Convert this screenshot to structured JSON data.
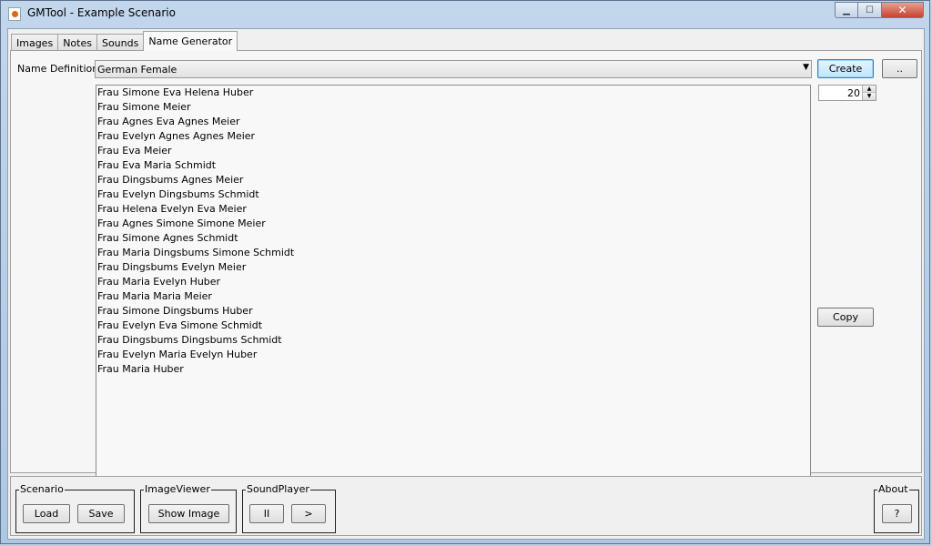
{
  "window": {
    "title": "GMTool - Example Scenario",
    "controls": {
      "minimize": "▁",
      "maximize": "☐",
      "close": "✕"
    }
  },
  "tabs": [
    {
      "label": "Images",
      "active": false
    },
    {
      "label": "Notes",
      "active": false
    },
    {
      "label": "Sounds",
      "active": false
    },
    {
      "label": "Name Generator",
      "active": true
    }
  ],
  "name_generator": {
    "definition_label": "Name Definition:",
    "definition_value": "German Female",
    "create_label": "Create",
    "browse_label": "..",
    "copy_label": "Copy",
    "count": "20",
    "names": [
      "Frau Simone Eva Helena Huber",
      "Frau Simone Meier",
      "Frau Agnes Eva Agnes Meier",
      "Frau Evelyn Agnes Agnes Meier",
      "Frau Eva Meier",
      "Frau Eva Maria Schmidt",
      "Frau Dingsbums Agnes Meier",
      "Frau Evelyn Dingsbums Schmidt",
      "Frau Helena Evelyn Eva Meier",
      "Frau Agnes Simone Simone Meier",
      "Frau Simone Agnes Schmidt",
      "Frau Maria Dingsbums Simone Schmidt",
      "Frau Dingsbums Evelyn Meier",
      "Frau Maria Evelyn Huber",
      "Frau Maria Maria Meier",
      "Frau Simone Dingsbums Huber",
      "Frau Evelyn Eva Simone Schmidt",
      "Frau Dingsbums Dingsbums Schmidt",
      "Frau Evelyn Maria Evelyn Huber",
      "Frau Maria Huber"
    ]
  },
  "bottom": {
    "scenario": {
      "title": "Scenario",
      "load": "Load",
      "save": "Save"
    },
    "image_viewer": {
      "title": "ImageViewer",
      "show": "Show Image"
    },
    "sound_player": {
      "title": "SoundPlayer",
      "pause": "II",
      "play": ">"
    },
    "about": {
      "title": "About",
      "help": "?"
    }
  }
}
